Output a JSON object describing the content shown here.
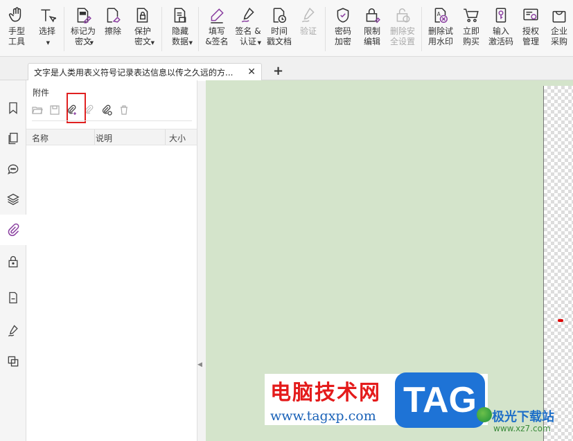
{
  "ribbon": {
    "groups": [
      {
        "items": [
          {
            "name": "hand-tool",
            "label": "手型\n工具",
            "icon": "hand-icon",
            "caret": false
          },
          {
            "name": "select-tool",
            "label": "选择",
            "icon": "text-cursor-icon",
            "caret": true
          }
        ]
      },
      {
        "items": [
          {
            "name": "mark-redact",
            "label": "标记为\n密文",
            "icon": "mark-redact-icon",
            "caret": true
          },
          {
            "name": "erase",
            "label": "擦除",
            "icon": "eraser-icon",
            "caret": false
          },
          {
            "name": "protect-redact",
            "label": "保护\n密文",
            "icon": "protect-doc-icon",
            "caret": true
          }
        ]
      },
      {
        "items": [
          {
            "name": "hide-data",
            "label": "隐藏\n数据",
            "icon": "hide-data-icon",
            "caret": true
          }
        ]
      },
      {
        "items": [
          {
            "name": "fill-sign",
            "label": "填写\n&签名",
            "icon": "pen-icon",
            "caret": false
          },
          {
            "name": "sign-certify",
            "label": "签名 &\n认证",
            "icon": "signature-icon",
            "caret": true
          },
          {
            "name": "timestamp",
            "label": "时间\n戳文档",
            "icon": "clock-doc-icon",
            "caret": false
          },
          {
            "name": "verify",
            "label": "验证",
            "icon": "verify-icon",
            "caret": false,
            "disabled": true
          }
        ]
      },
      {
        "items": [
          {
            "name": "password-encrypt",
            "label": "密码\n加密",
            "icon": "shield-lock-icon",
            "caret": false
          },
          {
            "name": "restrict-edit",
            "label": "限制\n编辑",
            "icon": "lock-edit-icon",
            "caret": false
          },
          {
            "name": "remove-security",
            "label": "删除安\n全设置",
            "icon": "unlock-icon",
            "caret": false,
            "disabled": true
          }
        ]
      },
      {
        "items": [
          {
            "name": "remove-trial-watermark",
            "label": "删除试\n用水印",
            "icon": "watermark-remove-icon",
            "caret": false
          },
          {
            "name": "buy-now",
            "label": "立即\n购买",
            "icon": "cart-icon",
            "caret": false
          },
          {
            "name": "enter-code",
            "label": "输入\n激活码",
            "icon": "key-icon",
            "caret": false
          },
          {
            "name": "license-manage",
            "label": "授权\n管理",
            "icon": "license-icon",
            "caret": false
          },
          {
            "name": "enterprise-buy",
            "label": "企业\n采购",
            "icon": "bag-icon",
            "caret": false
          }
        ]
      }
    ]
  },
  "tabs": {
    "doc_title": "文字是人类用表义符号记录表达信息以传之久远的方...",
    "close_glyph": "✕",
    "new_glyph": "+"
  },
  "panel": {
    "title": "附件",
    "columns": [
      "名称",
      "说明",
      "大小"
    ]
  },
  "watermark": {
    "cn_title": "电脑技术网",
    "url": "www.tagxp.com",
    "tag": "TAG",
    "site_name": "极光下载站",
    "site_url": "www.xz7.com"
  },
  "colors": {
    "doc_background": "#d4e4cb",
    "highlight": "#e02020",
    "accent_purple": "#8a3fa0"
  }
}
